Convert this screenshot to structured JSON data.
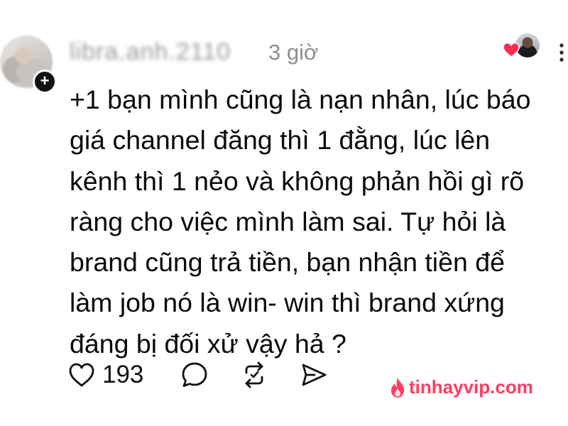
{
  "post": {
    "username": "libra.anh.2110",
    "time": "3 giờ",
    "content_lines": [
      "+1 bạn mình cũng là nạn nhân, lúc báo",
      "giá channel đăng thì 1 đằng, lúc lên",
      "kênh thì 1 nẻo và không phản hồi gì rõ",
      "ràng cho việc mình làm sai. Tự hỏi là",
      "brand cũng trả tiền, bạn nhận tiền để",
      "làm job nó là win- win thì brand xứng",
      "đáng bị đối xử vậy hả ?"
    ],
    "like_count": "193",
    "avatar_badge": "+"
  },
  "icons": {
    "like": "heart-outline-icon",
    "comment": "speech-bubble-icon",
    "repost": "repost-arrows-icon",
    "share": "paper-plane-icon",
    "more": "more-vertical-icon",
    "liked": "heart-filled-icon"
  },
  "colors": {
    "text": "#0a0a0a",
    "muted": "#8e8e8e",
    "heart": "#ff2d55",
    "watermark": "#ff3c5f"
  },
  "watermark": {
    "text": "tinhayvip.com"
  }
}
